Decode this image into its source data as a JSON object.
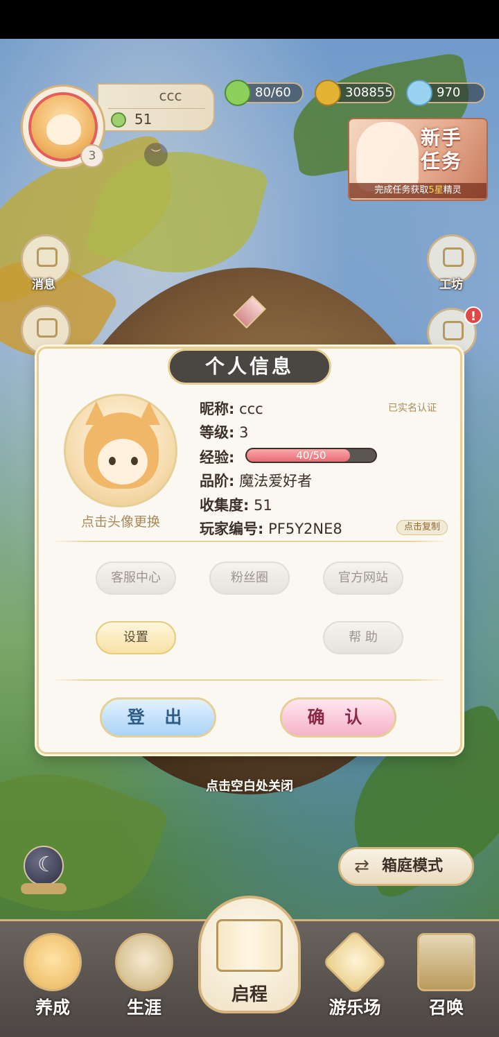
{
  "header": {
    "nickname": "ccc",
    "collection_count": "51",
    "player_level": "3",
    "resources": [
      {
        "name": "stamina",
        "value": "80/60",
        "icon": "clover-icon",
        "color": "#8ccf5a"
      },
      {
        "name": "gold",
        "value": "308855",
        "icon": "gold-coin-icon",
        "color": "#e4b234"
      },
      {
        "name": "gems",
        "value": "970",
        "icon": "diamond-icon",
        "color": "#9ad3ef"
      }
    ],
    "newbie_banner": {
      "title_line1": "新手",
      "title_line2": "任务",
      "subtitle_prefix": "完成任务获取",
      "subtitle_highlight": "5星",
      "subtitle_suffix": "精灵"
    }
  },
  "side_buttons": {
    "messages": "消息",
    "workshop": "工坊",
    "notification_badge": "!"
  },
  "profile_panel": {
    "title": "个人信息",
    "nickname_label": "昵称:",
    "nickname_value": "ccc",
    "verified": "已实名认证",
    "level_label": "等级:",
    "level_value": "3",
    "exp_label": "经验:",
    "exp_text": "40/50",
    "exp_fraction": 0.8,
    "rank_label": "品阶:",
    "rank_value": "魔法爱好者",
    "collection_label": "收集度:",
    "collection_value": "51",
    "player_id_label": "玩家编号:",
    "player_id_value": "PF5Y2NE8",
    "copy_button": "点击复制",
    "change_avatar": "点击头像更换",
    "menu": {
      "customer_service": "客服中心",
      "fan_circle": "粉丝圈",
      "official_site": "官方网站",
      "settings": "设置",
      "help": "帮 助"
    },
    "logout": "登 出",
    "confirm": "确 认"
  },
  "close_hint": "点击空白处关闭",
  "mode_button": "箱庭模式",
  "bottom_nav": [
    {
      "label": "养成",
      "icon": "nurture-icon"
    },
    {
      "label": "生涯",
      "icon": "crown-icon"
    },
    {
      "label": "启程",
      "icon": "book-icon"
    },
    {
      "label": "游乐场",
      "icon": "playground-icon"
    },
    {
      "label": "召唤",
      "icon": "summon-card-icon"
    }
  ]
}
